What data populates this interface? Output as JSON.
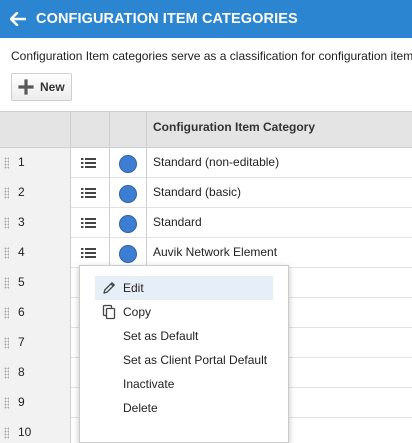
{
  "header": {
    "title": "CONFIGURATION ITEM CATEGORIES",
    "bg": "#2b85d0"
  },
  "description": "Configuration Item categories serve as a classification for configuration item",
  "toolbar": {
    "new_label": "New"
  },
  "grid": {
    "column_header": "Configuration Item Category",
    "rows": [
      {
        "num": "1",
        "name": "Standard (non-editable)"
      },
      {
        "num": "2",
        "name": "Standard (basic)"
      },
      {
        "num": "3",
        "name": "Standard"
      },
      {
        "num": "4",
        "name": "Auvik Network Element"
      },
      {
        "num": "5",
        "name": ""
      },
      {
        "num": "6",
        "name": ""
      },
      {
        "num": "7",
        "name": ""
      },
      {
        "num": "8",
        "name": ""
      },
      {
        "num": "9",
        "name": ""
      },
      {
        "num": "10",
        "name": ""
      }
    ]
  },
  "context_menu": {
    "items": [
      {
        "label": "Edit",
        "icon": "pencil-icon"
      },
      {
        "label": "Copy",
        "icon": "copy-icon"
      },
      {
        "label": "Set as Default",
        "icon": ""
      },
      {
        "label": "Set as Client Portal Default",
        "icon": ""
      },
      {
        "label": "Inactivate",
        "icon": ""
      },
      {
        "label": "Delete",
        "icon": ""
      }
    ]
  },
  "colors": {
    "accent": "#2b85d0",
    "category_dot": "#3d7ed2",
    "header_row": "#e4e4e4"
  }
}
